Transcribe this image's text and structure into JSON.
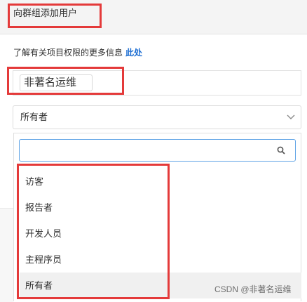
{
  "section": {
    "title": "向群组添加用户"
  },
  "info": {
    "text": "了解有关项目权限的更多信息",
    "link": "此处"
  },
  "user_field": {
    "token": "非著名运维"
  },
  "role_select": {
    "value": "所有者",
    "chevron_icon": "chevron-down-icon"
  },
  "dropdown": {
    "search_value": "",
    "search_icon": "search-icon",
    "options": [
      {
        "label": "访客"
      },
      {
        "label": "报告者"
      },
      {
        "label": "开发人员"
      },
      {
        "label": "主程序员"
      },
      {
        "label": "所有者",
        "selected": true
      }
    ]
  },
  "watermark": {
    "text": "CSDN @非著名运维"
  },
  "colors": {
    "highlight_box": "#e43a3a",
    "link": "#1f6fd2",
    "focus_border": "#5fa3e6"
  }
}
